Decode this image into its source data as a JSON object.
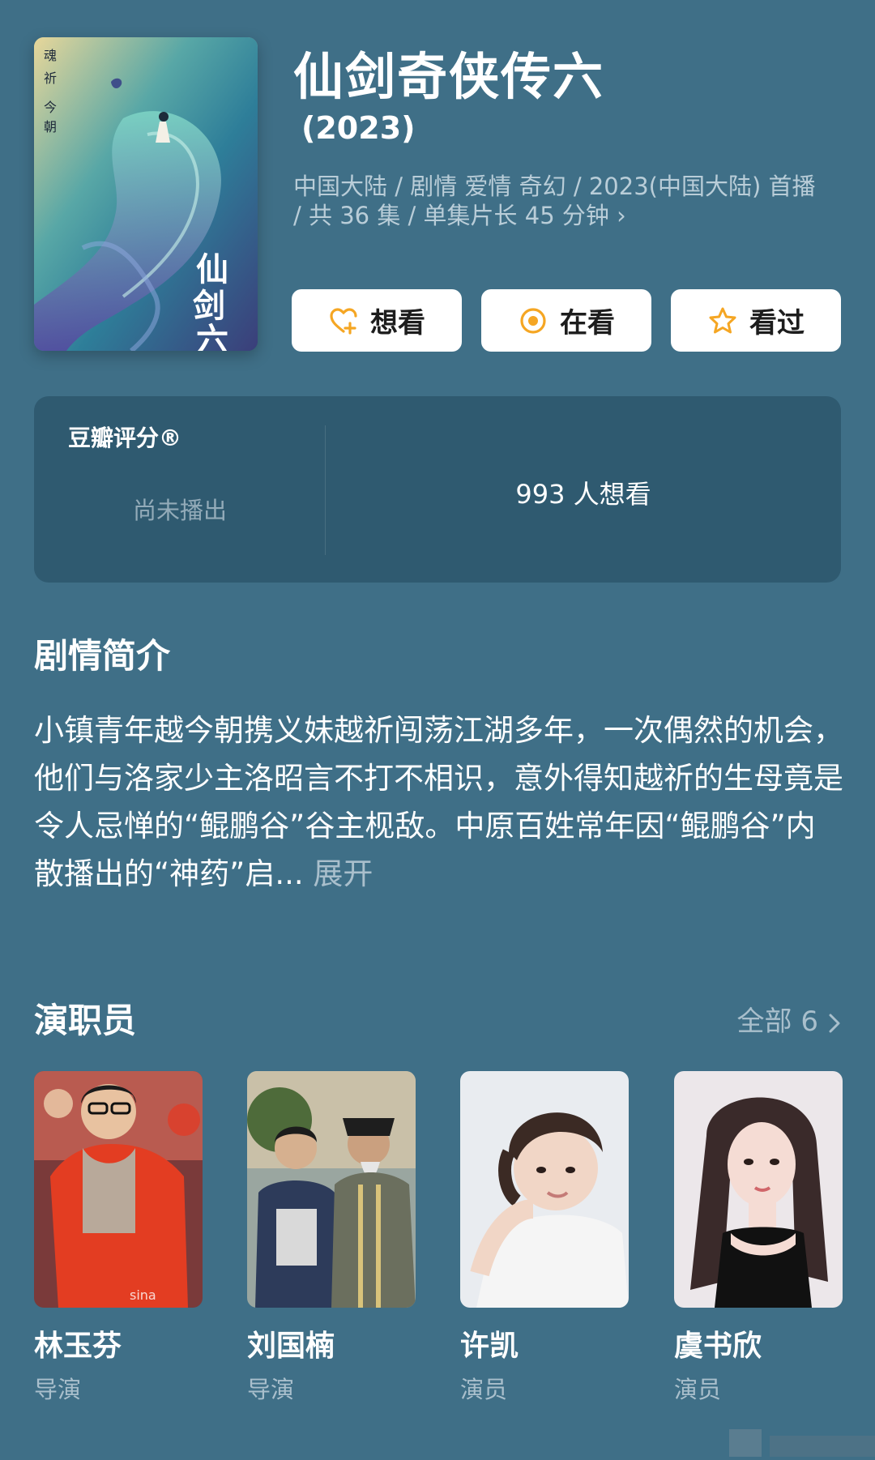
{
  "header": {
    "title": "仙剑奇侠传六",
    "year": "(2023)",
    "meta": "中国大陆 / 剧情 爱情 奇幻 / 2023(中国大陆) 首播 / 共 36 集 / 单集片长 45 分钟 ›",
    "poster_icon": "poster-image"
  },
  "actions": [
    {
      "label": "想看",
      "icon": "heart-plus-icon"
    },
    {
      "label": "在看",
      "icon": "target-dot-icon"
    },
    {
      "label": "看过",
      "icon": "star-outline-icon"
    }
  ],
  "rating": {
    "label": "豆瓣评分®",
    "status": "尚未播出",
    "want_count": "993 人想看"
  },
  "synopsis": {
    "title": "剧情简介",
    "text": "小镇青年越今朝携义妹越祈闯荡江湖多年，一次偶然的机会，他们与洛家少主洛昭言不打不相识，意外得知越祈的生母竟是令人忌惮的“鲲鹏谷”谷主枧敌。中原百姓常年因“鲲鹏谷”内散播出的“神药”启...",
    "more": "展开"
  },
  "cast": {
    "title": "演职员",
    "see_all": "全部 6",
    "members": [
      {
        "name": "林玉芬",
        "role": "导演"
      },
      {
        "name": "刘国楠",
        "role": "导演"
      },
      {
        "name": "许凯",
        "role": "演员"
      },
      {
        "name": "虞书欣",
        "role": "演员"
      }
    ]
  },
  "colors": {
    "background": "#3f6f87",
    "card": "#2f5a70",
    "accent": "#f5a623",
    "muted": "#a9bfcc"
  }
}
